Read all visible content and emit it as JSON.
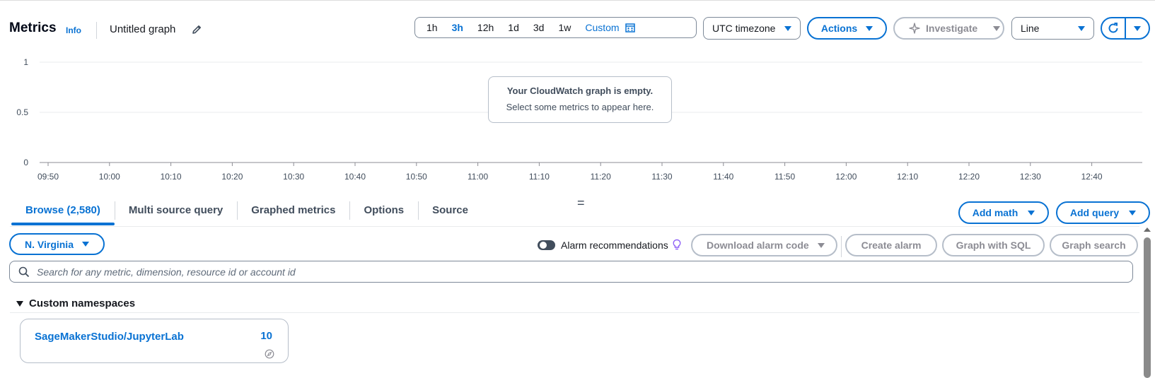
{
  "header": {
    "title": "Metrics",
    "info_label": "Info",
    "graph_name": "Untitled graph"
  },
  "time_range": {
    "options": [
      "1h",
      "3h",
      "12h",
      "1d",
      "3d",
      "1w"
    ],
    "selected": "3h",
    "custom_label": "Custom"
  },
  "timezone": {
    "value": "UTC timezone"
  },
  "actions_label": "Actions",
  "investigate_label": "Investigate",
  "chart_type": {
    "value": "Line"
  },
  "chart_data": {
    "type": "line",
    "title": "",
    "xlabel": "",
    "ylabel": "",
    "x_ticks": [
      "09:50",
      "10:00",
      "10:10",
      "10:20",
      "10:30",
      "10:40",
      "10:50",
      "11:00",
      "11:10",
      "11:20",
      "11:30",
      "11:40",
      "11:50",
      "12:00",
      "12:10",
      "12:20",
      "12:30",
      "12:40"
    ],
    "y_ticks": [
      "1",
      "0.5",
      "0"
    ],
    "ylim": [
      0,
      1
    ],
    "series": [],
    "grid": true
  },
  "empty_state": {
    "title": "Your CloudWatch graph is empty.",
    "message": "Select some metrics to appear here."
  },
  "tabs": [
    {
      "label": "Browse (2,580)",
      "active": true
    },
    {
      "label": "Multi source query",
      "active": false
    },
    {
      "label": "Graphed metrics",
      "active": false
    },
    {
      "label": "Options",
      "active": false
    },
    {
      "label": "Source",
      "active": false
    }
  ],
  "add_math_label": "Add math",
  "add_query_label": "Add query",
  "region_label": "N. Virginia",
  "alarm_recommendations_label": "Alarm recommendations",
  "download_alarm_code_label": "Download alarm code",
  "create_alarm_label": "Create alarm",
  "graph_with_sql_label": "Graph with SQL",
  "graph_search_label": "Graph search",
  "search": {
    "placeholder": "Search for any metric, dimension, resource id or account id",
    "value": ""
  },
  "custom_namespaces": {
    "heading": "Custom namespaces",
    "items": [
      {
        "name": "SageMakerStudio/JupyterLab",
        "count": "10"
      }
    ]
  },
  "colors": {
    "accent": "#0972d3",
    "disabled": "#8c8c94",
    "text": "#16191f"
  }
}
